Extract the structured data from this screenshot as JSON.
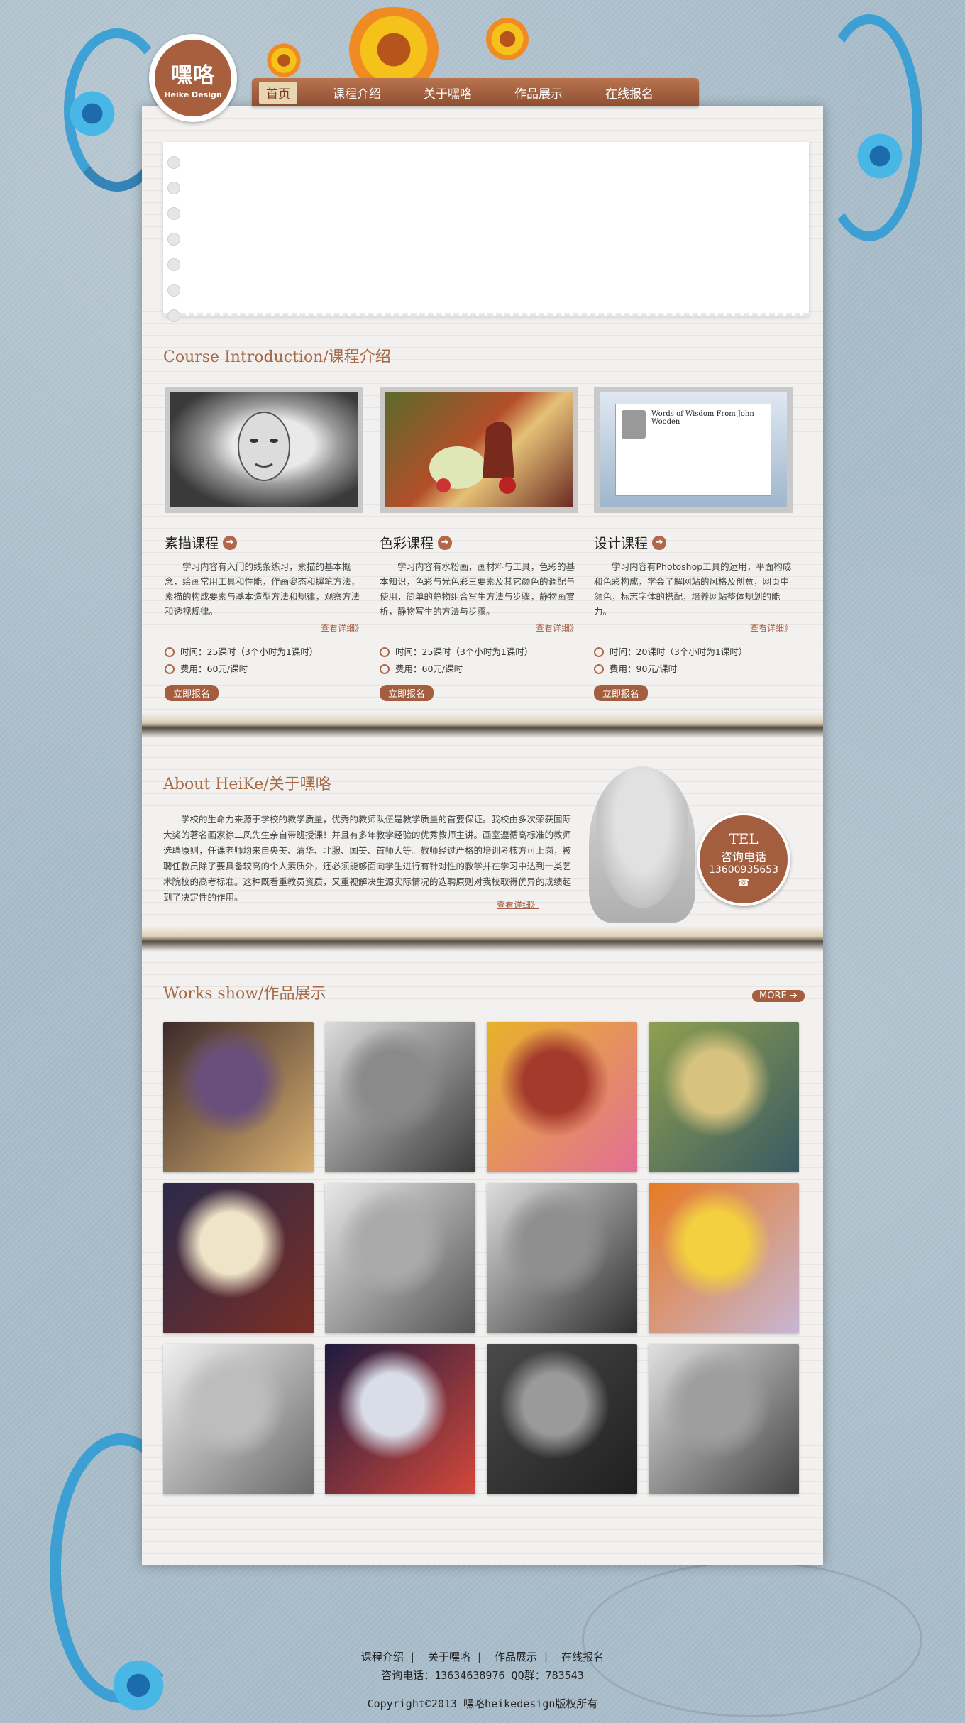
{
  "logo": {
    "title": "嘿咯",
    "subtitle": "Heike Design"
  },
  "nav": {
    "items": [
      {
        "label": "首页",
        "active": true
      },
      {
        "label": "课程介绍"
      },
      {
        "label": "关于嘿咯"
      },
      {
        "label": "作品展示"
      },
      {
        "label": "在线报名"
      }
    ]
  },
  "course_section": {
    "title": "Course Introduction/课程介绍",
    "courses": [
      {
        "title": "素描课程",
        "description": "学习内容有入门的线条练习，素描的基本概念，绘画常用工具和性能，作画姿态和握笔方法，素描的构成要素与基本造型方法和规律，观察方法和透视规律。",
        "more": "查看详细》",
        "time": "时间：25课时（3个小时为1课时）",
        "fee": "费用：60元/课时",
        "signup": "立即报名"
      },
      {
        "title": "色彩课程",
        "description": "学习内容有水粉画，画材料与工具，色彩的基本知识，色彩与光色彩三要素及其它颜色的调配与使用，简单的静物组合写生方法与步骤，静物画赏析，静物写生的方法与步骤。",
        "more": "查看详细》",
        "time": "时间：25课时（3个小时为1课时）",
        "fee": "费用：60元/课时",
        "signup": "立即报名"
      },
      {
        "title": "设计课程",
        "description": "学习内容有Photoshop工具的运用，平面构成和色彩构成，学会了解网站的风格及创意，网页中颜色，标志字体的搭配，培养网站整体规划的能力。",
        "more": "查看详细》",
        "time": "时间：20课时（3个小时为1课时）",
        "fee": "费用：90元/课时",
        "signup": "立即报名"
      }
    ],
    "design_thumb": {
      "quote": "Words of Wisdom From John Wooden"
    }
  },
  "about_section": {
    "title": "About HeiKe/关于嘿咯",
    "text": "学校的生命力来源于学校的教学质量，优秀的教师队伍是教学质量的首要保证。我校由多次荣获国际大奖的著名画家徐二凤先生亲自带班授课！并且有多年教学经验的优秀教师主讲。画室遵循高标准的教师选聘原则，任课老师均来自央美、清华、北服、国美、首师大等。教师经过严格的培训考核方可上岗，被聘任教员除了要具备较高的个人素质外，还必须能够面向学生进行有针对性的教学并在学习中达到一类艺术院校的高考标准。这种既看重教员资质，又重视解决生源实际情况的选聘原则对我校取得优异的成绩起到了决定性的作用。",
    "more": "查看详细》",
    "tel": {
      "title": "TEL",
      "label": "咨询电话",
      "number": "13600935653"
    }
  },
  "works_section": {
    "title": "Works show/作品展示",
    "more": "MORE ➔",
    "works": [
      {
        "name": "still-life-vase-purple",
        "colors": [
          "#3d2a2a",
          "#6a4f7c",
          "#d8b070"
        ]
      },
      {
        "name": "sketch-old-man-profile",
        "colors": [
          "#dcdcdc",
          "#8a8a8a",
          "#3b3b3b"
        ]
      },
      {
        "name": "still-life-flowers-yellow",
        "colors": [
          "#e7b22a",
          "#a33a2c",
          "#e36f95"
        ]
      },
      {
        "name": "still-life-bottle-green",
        "colors": [
          "#8fa04e",
          "#d7c37f",
          "#3a5a63"
        ]
      },
      {
        "name": "still-life-book-dark",
        "colors": [
          "#2b2a4a",
          "#efe4c8",
          "#7a2e24"
        ]
      },
      {
        "name": "sketch-cube",
        "colors": [
          "#e8e8e8",
          "#aaaaaa",
          "#555555"
        ]
      },
      {
        "name": "sketch-still-life-pot",
        "colors": [
          "#dddddd",
          "#8f8f8f",
          "#2e2e2e"
        ]
      },
      {
        "name": "still-life-orange-flowers",
        "colors": [
          "#e87a22",
          "#f3d03f",
          "#c6b6d4"
        ]
      },
      {
        "name": "sketch-geometric-shapes",
        "colors": [
          "#f0f0f0",
          "#bdbdbd",
          "#6a6a6a"
        ]
      },
      {
        "name": "still-life-black-jar",
        "colors": [
          "#1d1b40",
          "#d9dde8",
          "#d4473a"
        ]
      },
      {
        "name": "sketch-old-man-face",
        "colors": [
          "#4a4a4a",
          "#9a9a9a",
          "#1f1f1f"
        ]
      },
      {
        "name": "sketch-bottle-jar",
        "colors": [
          "#e0e0e0",
          "#9e9e9e",
          "#444444"
        ]
      }
    ]
  },
  "footer": {
    "links": [
      "课程介绍",
      "关于嘿咯",
      "作品展示",
      "在线报名"
    ],
    "contact": "咨询电话：13634638976   QQ群：783543",
    "copyright": "Copyright©2013 嘿咯heikedesign版权所有"
  }
}
